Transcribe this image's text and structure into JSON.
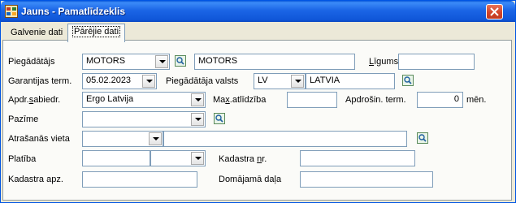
{
  "window": {
    "title": "Jauns - Pamatlīdzeklis"
  },
  "tabs": [
    {
      "label": "Galvenie dati",
      "active": false
    },
    {
      "label": "Pārējie dati",
      "active": true
    }
  ],
  "form": {
    "supplier": {
      "label": "Piegādātājs",
      "code": "MOTORS",
      "name": "MOTORS"
    },
    "contract": {
      "label_prefix": "L",
      "label_rest": "īgums",
      "value": ""
    },
    "warranty": {
      "label": "Garantijas term.",
      "value": "05.02.2023"
    },
    "supplier_country": {
      "label": "Piegādātāja valsts",
      "code": "LV",
      "name": "LATVIA"
    },
    "insurer": {
      "label_prefix": "Apdr.",
      "label_u": "s",
      "label_rest": "abiedr.",
      "value": "Ergo Latvija"
    },
    "max_liability": {
      "label_prefix": "Ma",
      "label_u": "x",
      "label_rest": ".atlīdzība",
      "value": ""
    },
    "insurance_term": {
      "label": "Apdrošin. term.",
      "value": "0",
      "unit": "mēn."
    },
    "feature": {
      "label": "Pazīme",
      "value": ""
    },
    "location": {
      "label": "Atrašanās vieta",
      "code": "",
      "name": ""
    },
    "area": {
      "label": "Platība",
      "value": "",
      "unit": ""
    },
    "cadastre_no": {
      "label_prefix": "Kadastra ",
      "label_u": "n",
      "label_rest": "r.",
      "value": ""
    },
    "cadastre_area": {
      "label": "Kadastra apz.",
      "value": ""
    },
    "notional_part": {
      "label_prefix": "Domājamā da",
      "label_u": "ļ",
      "label_rest": "a",
      "value": ""
    }
  },
  "colors": {
    "titlebar": "#0a58d8",
    "close": "#d2452b",
    "panel": "#fbfbf8",
    "border": "#7f9db9"
  },
  "icons": [
    "app-icon",
    "close-icon",
    "lookup-icon",
    "dropdown-arrow-icon"
  ]
}
